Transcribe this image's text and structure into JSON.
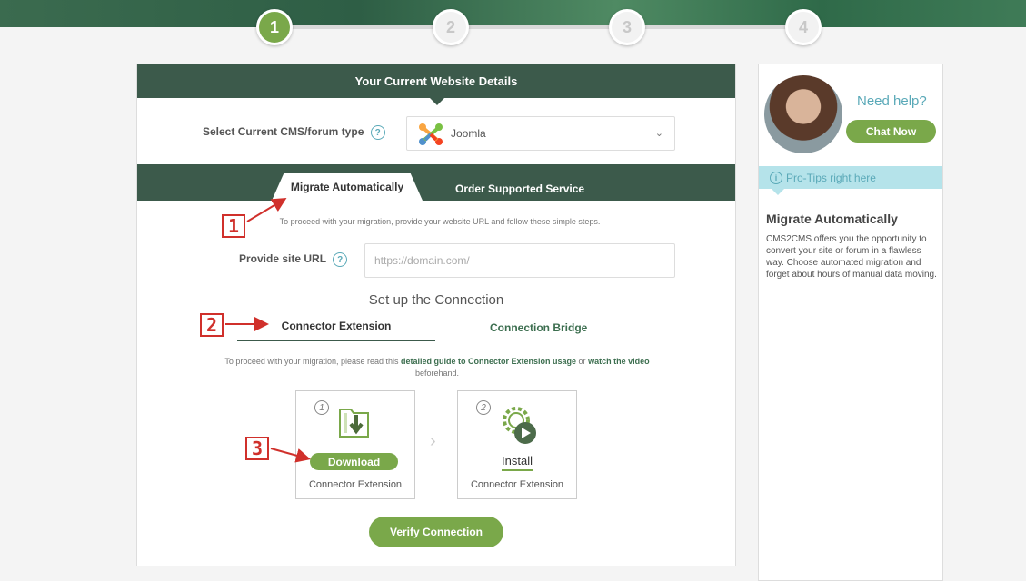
{
  "steps": [
    "1",
    "2",
    "3",
    "4"
  ],
  "active_step": 1,
  "panel": {
    "title": "Your Current Website Details",
    "cms_label": "Select Current CMS/forum type",
    "cms_value": "Joomla",
    "help_icon": "?"
  },
  "tabs": {
    "active": "Migrate Automatically",
    "other": "Order Supported Service"
  },
  "intro_hint": "To proceed with your migration, provide your website URL and follow these simple steps.",
  "url": {
    "label": "Provide site URL",
    "placeholder": "https://domain.com/",
    "value": ""
  },
  "setup_title": "Set up the Connection",
  "connection_tabs": {
    "active": "Connector Extension",
    "other": "Connection Bridge"
  },
  "guide_hint": {
    "before": "To proceed with your migration, please read this ",
    "link1": "detailed guide to Connector Extension usage",
    "middle": " or ",
    "link2": "watch the video",
    "after": " beforehand."
  },
  "cards": [
    {
      "number": "1",
      "action": "Download",
      "subtitle": "Connector Extension"
    },
    {
      "number": "2",
      "action": "Install",
      "subtitle": "Connector Extension"
    }
  ],
  "verify_label": "Verify Connection",
  "markers": [
    "1",
    "2",
    "3"
  ],
  "sidebar": {
    "need_help": "Need help?",
    "chat_label": "Chat Now",
    "protips": "Pro-Tips right here",
    "tip_title": "Migrate Automatically",
    "tip_text": "CMS2CMS offers you the opportunity to convert your site or forum in a flawless way. Choose automated migration and forget about hours of manual data moving."
  },
  "colors": {
    "dark_green": "#3c5a4b",
    "accent_green": "#7aa84a",
    "teal": "#5aa9b8",
    "marker_red": "#d0302b"
  }
}
